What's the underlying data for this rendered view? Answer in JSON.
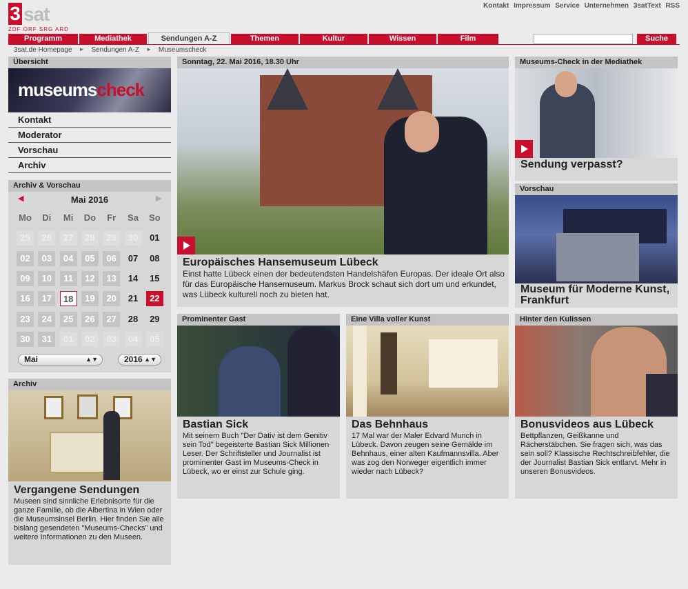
{
  "logo": {
    "number": "3",
    "name": "sat",
    "partners": "ZDF ORF SRG ARD"
  },
  "top_links": [
    "Kontakt",
    "Impressum",
    "Service",
    "Unternehmen",
    "3satText",
    "RSS"
  ],
  "nav": [
    "Programm",
    "Mediathek",
    "Sendungen A-Z",
    "Themen",
    "Kultur",
    "Wissen",
    "Film"
  ],
  "search": {
    "placeholder": "",
    "button": "Suche"
  },
  "breadcrumb": [
    "3sat.de Homepage",
    "Sendungen A-Z",
    "Museumscheck"
  ],
  "sidebar": {
    "overview_title": "Übersicht",
    "banner_part1": "museums",
    "banner_part2": "check",
    "menu": [
      "Kontakt",
      "Moderator",
      "Vorschau",
      "Archiv"
    ],
    "calendar_title": "Archiv & Vorschau",
    "month_label": "Mai 2016",
    "weekdays": [
      "Mo",
      "Di",
      "Mi",
      "Do",
      "Fr",
      "Sa",
      "So"
    ],
    "weeks": [
      [
        "25",
        "26",
        "27",
        "28",
        "29",
        "30",
        "01"
      ],
      [
        "02",
        "03",
        "04",
        "05",
        "06",
        "07",
        "08"
      ],
      [
        "09",
        "10",
        "11",
        "12",
        "13",
        "14",
        "15"
      ],
      [
        "16",
        "17",
        "18",
        "19",
        "20",
        "21",
        "22"
      ],
      [
        "23",
        "24",
        "25",
        "26",
        "27",
        "28",
        "29"
      ],
      [
        "30",
        "31",
        "01",
        "02",
        "03",
        "04",
        "05"
      ]
    ],
    "month_select": "Mai",
    "year_select": "2016",
    "archive_title": "Archiv",
    "archive_heading": "Vergangene Sendungen",
    "archive_text": "Museen sind sinnliche Erlebnisorte für die ganze Familie, ob die Albertina in Wien oder die Museumsinsel Berlin. Hier finden Sie alle bislang gesendeten \"Museums-Checks\" und weitere Informationen zu den Museen."
  },
  "main": {
    "date_header": "Sonntag, 22. Mai 2016, 18.30 Uhr",
    "title": "Europäisches Hansemuseum Lübeck",
    "text": "Einst hatte Lübeck einen der bedeutendsten Handelshäfen Europas. Der ideale Ort also für das Europäische Hansemuseum. Markus Brock schaut sich dort um und erkundet, was Lübeck kulturell noch zu bieten hat."
  },
  "right": {
    "mediathek_header": "Museums-Check in der Mediathek",
    "mediathek_title": "Sendung verpasst?",
    "preview_header": "Vorschau",
    "preview_title": "Museum für Moderne Kunst, Frankfurt"
  },
  "teasers": [
    {
      "header": "Prominenter Gast",
      "title": "Bastian Sick",
      "text": "Mit seinem Buch \"Der Dativ ist dem Genitiv sein Tod\" begeisterte Bastian Sick Millionen Leser. Der Schriftsteller und Journalist ist prominenter Gast im Museums-Check in Lübeck, wo er einst zur Schule ging."
    },
    {
      "header": "Eine Villa voller Kunst",
      "title": "Das Behnhaus",
      "text": "17 Mal war der Maler Edvard Munch in Lübeck. Davon zeugen seine Gemälde im Behnhaus, einer alten Kaufmannsvilla. Aber was zog den Norweger eigentlich immer wieder nach Lübeck?"
    },
    {
      "header": "Hinter den Kulissen",
      "title": "Bonusvideos aus Lübeck",
      "text": "Bettpflanzen, Geißkanne und Rächerstäbchen. Sie fragen sich, was das sein soll? Klassische Rechtschreibfehler, die der Journalist Bastian Sick entlarvt. Mehr in unseren Bonusvideos."
    }
  ],
  "colors": {
    "brand": "#c8102e",
    "box": "#d7d7d7",
    "box_header": "#c4c4c4",
    "page": "#ebebeb"
  }
}
